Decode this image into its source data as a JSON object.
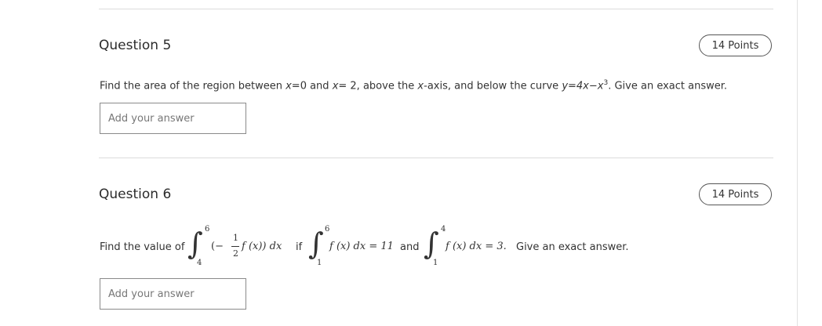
{
  "question5": {
    "title": "Question 5",
    "points": "14 Points",
    "text_prefix": "Find the area of the region between ",
    "x0": "x",
    "eq0": "=0 and ",
    "x2": "x",
    "eq2": "= 2, above the ",
    "xaxis": "x",
    "axis_text": "-axis, and below the curve ",
    "curve": "y=4x−x",
    "exp": "3",
    "text_suffix": ". Give an exact answer.",
    "placeholder": "Add your answer"
  },
  "question6": {
    "title": "Question 6",
    "points": "14 Points",
    "lead": "Find the value of",
    "int1_upper": "6",
    "int1_lower": "4",
    "int1_open": "(−",
    "frac_num": "1",
    "frac_den": "2",
    "int1_body": "f (x)) dx",
    "if_text": "if",
    "int2_upper": "6",
    "int2_lower": "1",
    "int2_body": "f (x)  dx = 11",
    "and_text": "and",
    "int3_upper": "4",
    "int3_lower": "1",
    "int3_body": "f (x)  dx = 3.",
    "tail": "Give an exact answer.",
    "placeholder": "Add your answer"
  }
}
